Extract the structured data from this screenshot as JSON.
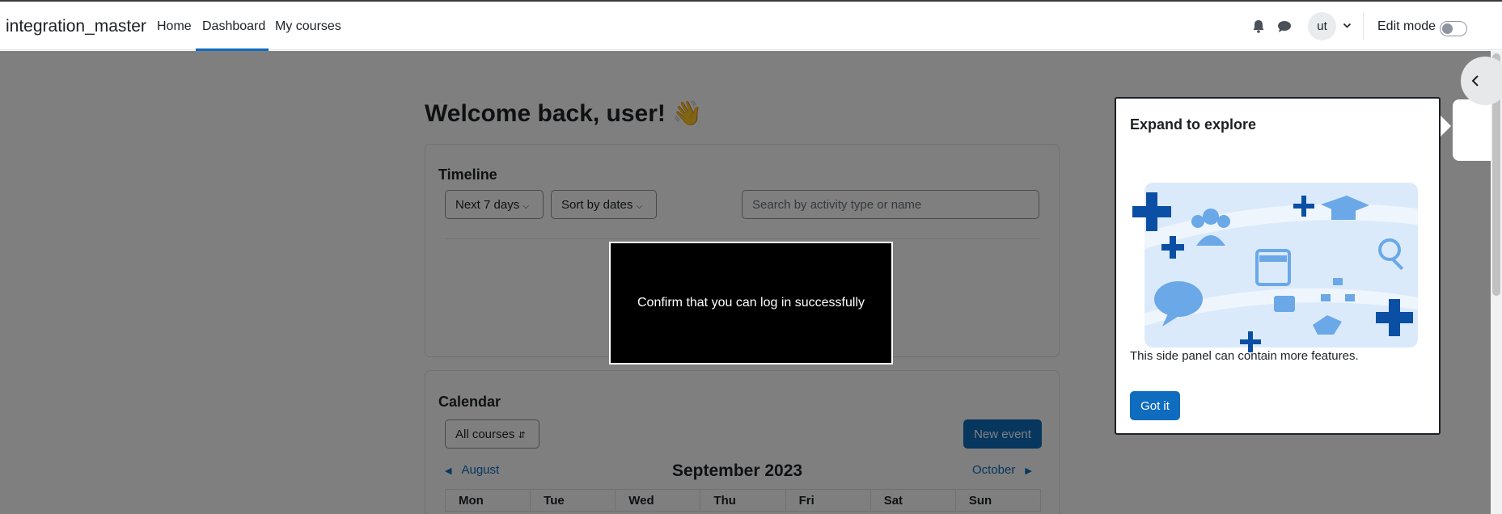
{
  "navbar": {
    "brand": "integration_master",
    "links": [
      "Home",
      "Dashboard",
      "My courses"
    ],
    "avatar_initials": "ut",
    "edit_mode_label": "Edit mode"
  },
  "page": {
    "welcome": "Welcome back, user! 👋"
  },
  "timeline": {
    "title": "Timeline",
    "range_select": "Next 7 days",
    "sort_select": "Sort by dates",
    "search_placeholder": "Search by activity type or name"
  },
  "calendar": {
    "title": "Calendar",
    "course_select": "All courses",
    "new_event": "New event",
    "prev_month": "August",
    "month_title": "September 2023",
    "next_month": "October",
    "weekdays": [
      "Mon",
      "Tue",
      "Wed",
      "Thu",
      "Fri",
      "Sat",
      "Sun"
    ]
  },
  "toast": {
    "message": "Confirm that you can log in successfully"
  },
  "popover": {
    "title": "Expand to explore",
    "body": "This side panel can contain more features.",
    "button": "Got it"
  },
  "icons": {
    "notifications": "bell-icon",
    "messages": "chat-icon",
    "drawer": "chevron-left-icon"
  },
  "colors": {
    "primary": "#0f6cbf",
    "overlay": "rgba(0,0,0,0.5)",
    "toast_bg": "#000000"
  }
}
